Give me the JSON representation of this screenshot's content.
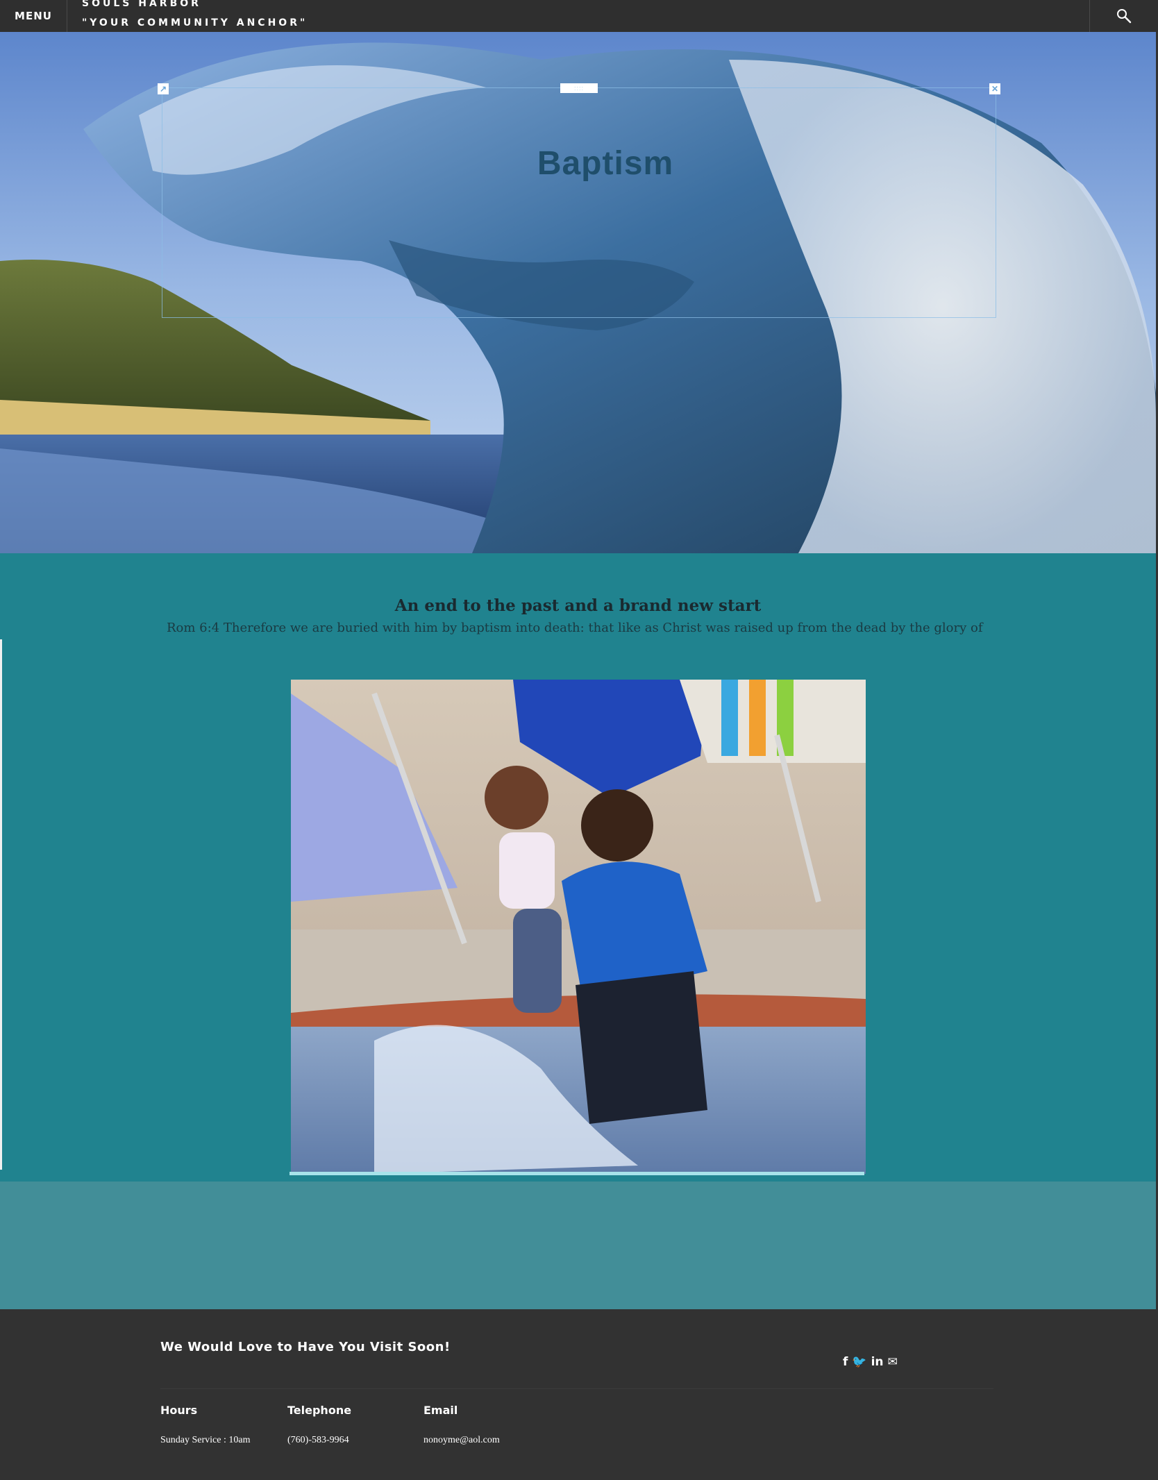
{
  "header": {
    "menu_label": "MENU",
    "site_name": "SOULS HARBOR",
    "tagline": "\"YOUR COMMUNITY ANCHOR\"",
    "search_icon": "search-icon"
  },
  "hero": {
    "title": "Baptism",
    "edit_handle_label": "::::",
    "edit_corner_left": "↗",
    "edit_corner_right": "✕"
  },
  "content": {
    "heading": "An end to the past and a brand new start",
    "verse": "Rom 6:4  Therefore we are buried with him by baptism into death: that like as Christ was raised up from the dead by the glory of"
  },
  "footer": {
    "invite": "We Would Love to Have You Visit Soon!",
    "social": [
      {
        "label": "f",
        "icon": "facebook-icon"
      },
      {
        "label": "🐦",
        "icon": "twitter-icon"
      },
      {
        "label": "in",
        "icon": "linkedin-icon"
      },
      {
        "label": "✉",
        "icon": "email-icon"
      }
    ],
    "columns": [
      {
        "heading": "Hours",
        "value": "Sunday Service : 10am"
      },
      {
        "heading": "Telephone",
        "value": "(760)-583-9964"
      },
      {
        "heading": "Email",
        "value": "nonoyme@aol.com"
      }
    ]
  },
  "colors": {
    "topbar": "#2f2f2f",
    "title": "#1f4e6b",
    "teal": "#20838f",
    "band": "#428e98",
    "footer": "#323232"
  }
}
